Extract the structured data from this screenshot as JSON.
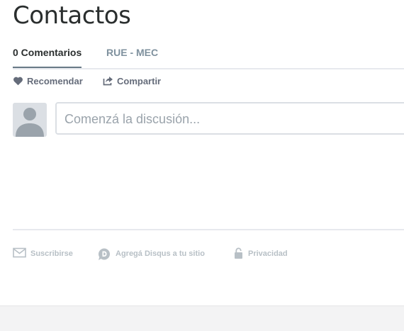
{
  "page": {
    "title": "Contactos"
  },
  "tabs": {
    "comments": "0 Comentarios",
    "forum": "RUE - MEC"
  },
  "actions": {
    "recommend": "Recomendar",
    "share": "Compartir"
  },
  "composer": {
    "placeholder": "Comenzá la discusión..."
  },
  "footer": {
    "subscribe": "Suscribirse",
    "add_disqus": "Agregá Disqus a tu sitio",
    "privacy": "Privacidad"
  },
  "icons": {
    "recommend": "heart-icon",
    "share": "share-icon",
    "avatar": "user-avatar-icon",
    "subscribe": "envelope-icon",
    "add_disqus": "disqus-logo-icon",
    "privacy": "lock-icon"
  },
  "colors": {
    "text": "#2a2e2e",
    "tab_inactive": "#7f919e",
    "muted": "#656c7a",
    "footer_text": "#b8c0c6",
    "divider": "#e7e9ee",
    "avatar_bg": "#dbdfe4"
  }
}
